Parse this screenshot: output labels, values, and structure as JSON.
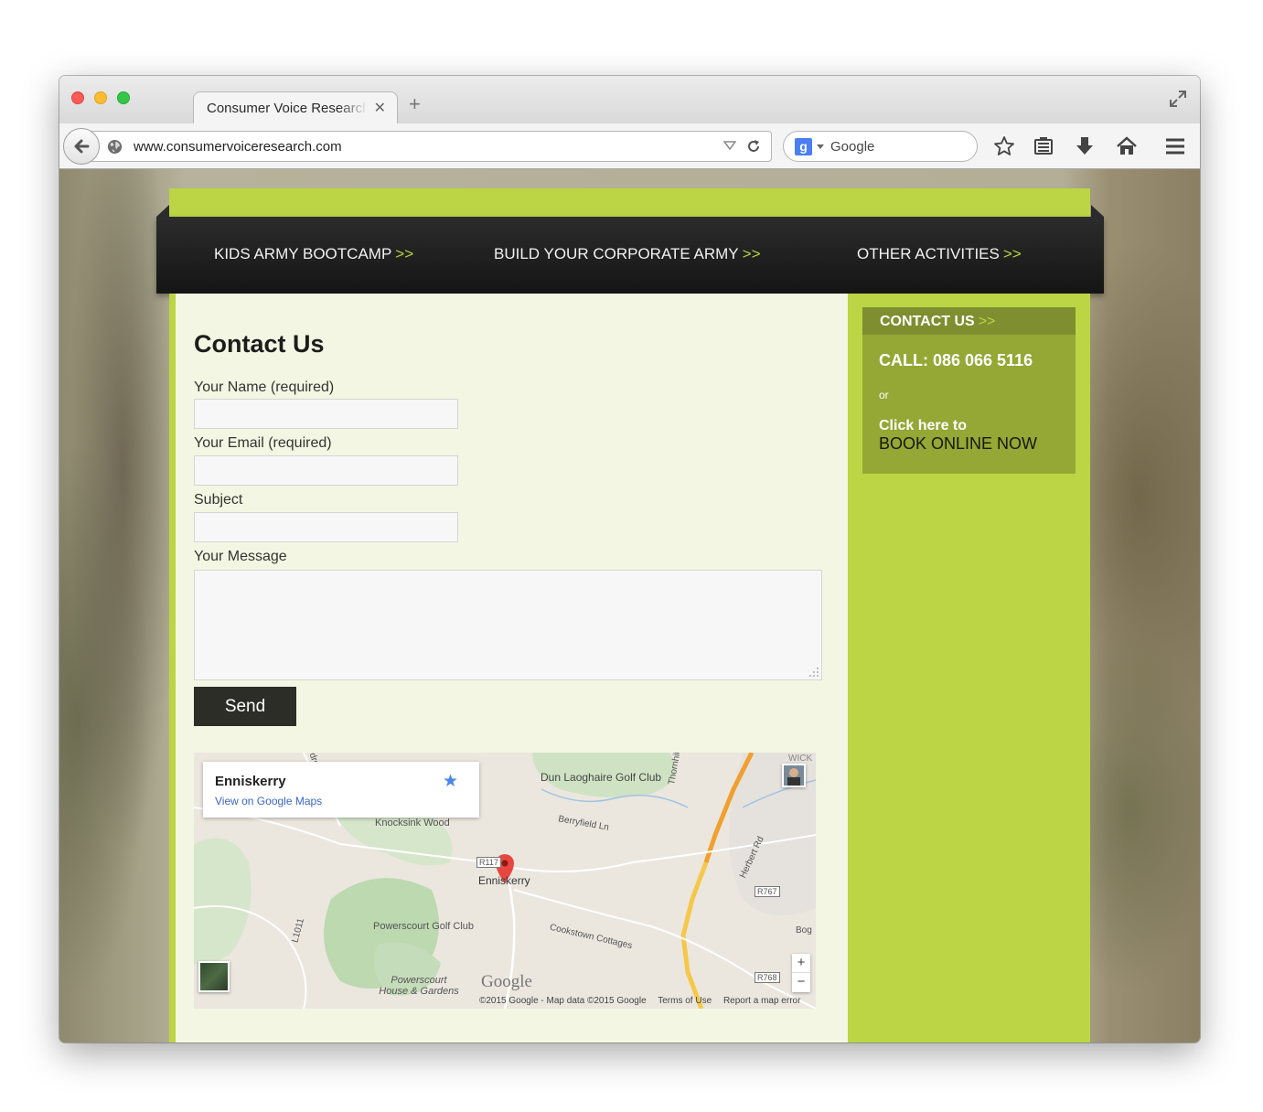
{
  "browser": {
    "tab_title": "Consumer Voice Research",
    "url": "www.consumervoiceresearch.com",
    "search_engine": "Google",
    "search_placeholder": "Google",
    "icons": [
      "back-icon",
      "globe-icon",
      "reload-icon",
      "bookmark-star-icon",
      "reading-list-icon",
      "download-icon",
      "home-icon",
      "menu-icon",
      "fullscreen-icon"
    ]
  },
  "nav": {
    "items": [
      {
        "label": "KIDS ARMY BOOTCAMP",
        "arrows": ">>"
      },
      {
        "label": "BUILD YOUR CORPORATE ARMY",
        "arrows": ">>"
      },
      {
        "label": "OTHER ACTIVITIES",
        "arrows": ">>"
      }
    ]
  },
  "form": {
    "title": "Contact Us",
    "name_label": "Your Name (required)",
    "name_value": "",
    "email_label": "Your Email (required)",
    "email_value": "",
    "subject_label": "Subject",
    "subject_value": "",
    "message_label": "Your Message",
    "message_value": "",
    "send_label": "Send"
  },
  "map": {
    "place_name": "Enniskerry",
    "view_link": "View on Google Maps",
    "labels": {
      "golf_dl": "Dun Laoghaire Golf Club",
      "knocksink": "Knocksink Wood",
      "berryfield": "Berryfield Ln",
      "thornhill": "Thornhill Rd",
      "herbert": "Herbert Rd",
      "r767": "R767",
      "r117": "R117",
      "enniskerry": "Enniskerry",
      "powerscourt_golf": "Powerscourt Golf Club",
      "cookstown": "Cookstown Cottages",
      "powerscourt_house": "Powerscourt House & Gardens",
      "l1011": "L1011",
      "r768": "R768",
      "bog": "Bog",
      "wick": "WICK",
      "dro": "dro"
    },
    "google_logo": "Google",
    "copyright": "©2015 Google - Map data ©2015 Google",
    "terms": "Terms of Use",
    "report": "Report a map error",
    "zoom_in": "+",
    "zoom_out": "−"
  },
  "sidebar": {
    "contact_title": "CONTACT US",
    "contact_arrows": ">>",
    "call": "CALL: 086 066 5116",
    "or": "or",
    "click_here": "Click here  to",
    "book_online": "BOOK ONLINE NOW"
  },
  "colors": {
    "accent_green": "#bbd545",
    "dark_nav": "#1d1d1d",
    "content_bg": "#f3f6e2",
    "contact_box": "#95a735",
    "send_button": "#2d2d27"
  }
}
